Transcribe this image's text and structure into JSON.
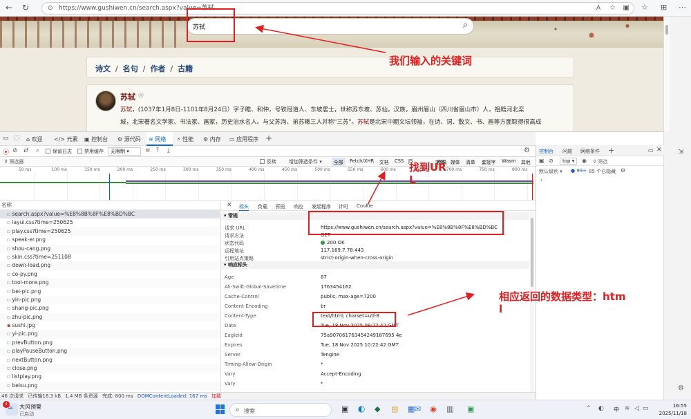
{
  "browser": {
    "url": "https://www.gushiwen.cn/search.aspx?value=苏轼"
  },
  "page": {
    "search_value": "苏轼",
    "nav": [
      "诗文",
      "名句",
      "作者",
      "古籍"
    ],
    "nav_sep": "/",
    "poet_name": "苏轼",
    "bio_line1_name": "苏轼",
    "bio_line1": "，(1037年1月8日-1101年8月24日）字子瞻、和仲，号铁冠道人、东坡居士，世称苏东坡、苏仙，汉族，眉州眉山（四川省眉山市）人，祖籍河北栾",
    "bio_line2": "城，北宋著名文学家、书法家、画家，历史治水名人。与父苏洵、弟苏辙三人并称\"三苏\"。",
    "bio_line2_name": "苏轼",
    "bio_line2_tail": "是北宋中期文坛领袖，在诗、词、散文、书、画等方面取得很高成"
  },
  "devtools": {
    "main_tabs": [
      "欢迎",
      "元素",
      "控制台",
      "源代码",
      "网络",
      "性能",
      "内存",
      "应用程序"
    ],
    "toolbar": {
      "preserve_log": "保留日志",
      "disable_cache": "禁用缓存",
      "throttle": "无限制"
    },
    "filter_bar": {
      "filter_placeholder": "筛选器",
      "invert": "反转",
      "more_filters": "增加筛选条件",
      "types": [
        "全部",
        "Fetch/XHR",
        "文档",
        "CSS",
        "JS",
        "字体",
        "图像",
        "媒体",
        "清单",
        "套接字",
        "Wasm",
        "其他"
      ]
    },
    "timeline_ticks": [
      "50 ms",
      "100 ms",
      "150 ms",
      "200 ms",
      "250 ms",
      "300 ms",
      "350 ms",
      "400 ms",
      "450 ms",
      "500 ms",
      "550 ms",
      "600 ms",
      "650 ms",
      "700 ms",
      "750 ms",
      "800 ms"
    ],
    "name_header": "名称",
    "requests": [
      "search.aspx?value=%E8%8B%8F%E8%BD%BC",
      "layui.css?time=250625",
      "play.css?time=250625",
      "speak-er.png",
      "shou-cang.png",
      "skin.css?time=251108",
      "down-load.png",
      "co-py.png",
      "tool-more.png",
      "bei-pic.png",
      "yin-pic.png",
      "shang-pic.png",
      "zhu-pic.png",
      "sushi.jpg",
      "yi-pic.png",
      "prevButton.png",
      "playPauseButton.png",
      "nextButton.png",
      "close.png",
      "listplay.png",
      "beisu.png"
    ],
    "detail_tabs": [
      "标头",
      "负载",
      "预览",
      "响应",
      "发起程序",
      "计时",
      "Cookie"
    ],
    "general_section": "▾ 常规",
    "general": [
      {
        "k": "请求 URL",
        "v": "https://www.gushiwen.cn/search.aspx?value=%E8%8B%8F%E8%BD%BC"
      },
      {
        "k": "请求方法",
        "v": "GET"
      },
      {
        "k": "状态代码",
        "v": "200 OK"
      },
      {
        "k": "远程地址",
        "v": "117.169.7.78:443"
      },
      {
        "k": "引用站点策略",
        "v": "strict-origin-when-cross-origin"
      }
    ],
    "response_section": "▾ 响应标头",
    "response_headers": [
      {
        "k": "Age",
        "v": "87"
      },
      {
        "k": "Ali-Swift-Global-Savetime",
        "v": "1763454162"
      },
      {
        "k": "Cache-Control",
        "v": "public, max-age=7200"
      },
      {
        "k": "Content-Encoding",
        "v": "br"
      },
      {
        "k": "Content-Type",
        "v": "text/html; charset=utf-8"
      },
      {
        "k": "Date",
        "v": "Tue, 18 Nov 2025 08:22:42 GMT"
      },
      {
        "k": "Eagleid",
        "v": "75a907061763454249187695 4e"
      },
      {
        "k": "Expires",
        "v": "Tue, 18 Nov 2025 10:22:42 GMT"
      },
      {
        "k": "Server",
        "v": "Tengine"
      },
      {
        "k": "Timing-Allow-Origin",
        "v": "*"
      },
      {
        "k": "Vary",
        "v": "Accept-Encoding"
      },
      {
        "k": "Vary",
        "v": "*"
      }
    ],
    "status_bar": {
      "requests": "46 次请求",
      "transferred": "已传输18.3 kB",
      "resources": "1.4 MB 条资源",
      "finish": "完成: 800 ms",
      "dcl": "DOMContentLoaded: 167 ms",
      "load": "加载"
    },
    "console_tabs": [
      "控制台",
      "问题",
      "网络条件"
    ],
    "console_toolbar": {
      "context": "top",
      "filter": "筛选",
      "level": "默认级别",
      "issues": "99+",
      "hidden": "85 个已隐藏"
    }
  },
  "annotations": {
    "keyword": "我们输入的关键词",
    "find_url_1": "找到UR",
    "find_url_2": "L",
    "content_type_1": "相应返回的数据类型：htm",
    "content_type_2": "l",
    "color": "#e02020"
  },
  "taskbar": {
    "weather_badge": "4",
    "weather_title": "大风预警",
    "weather_sub": "已启动",
    "search": "搜索",
    "ime": "中",
    "time": "16:55",
    "date": "2025/11/18"
  }
}
